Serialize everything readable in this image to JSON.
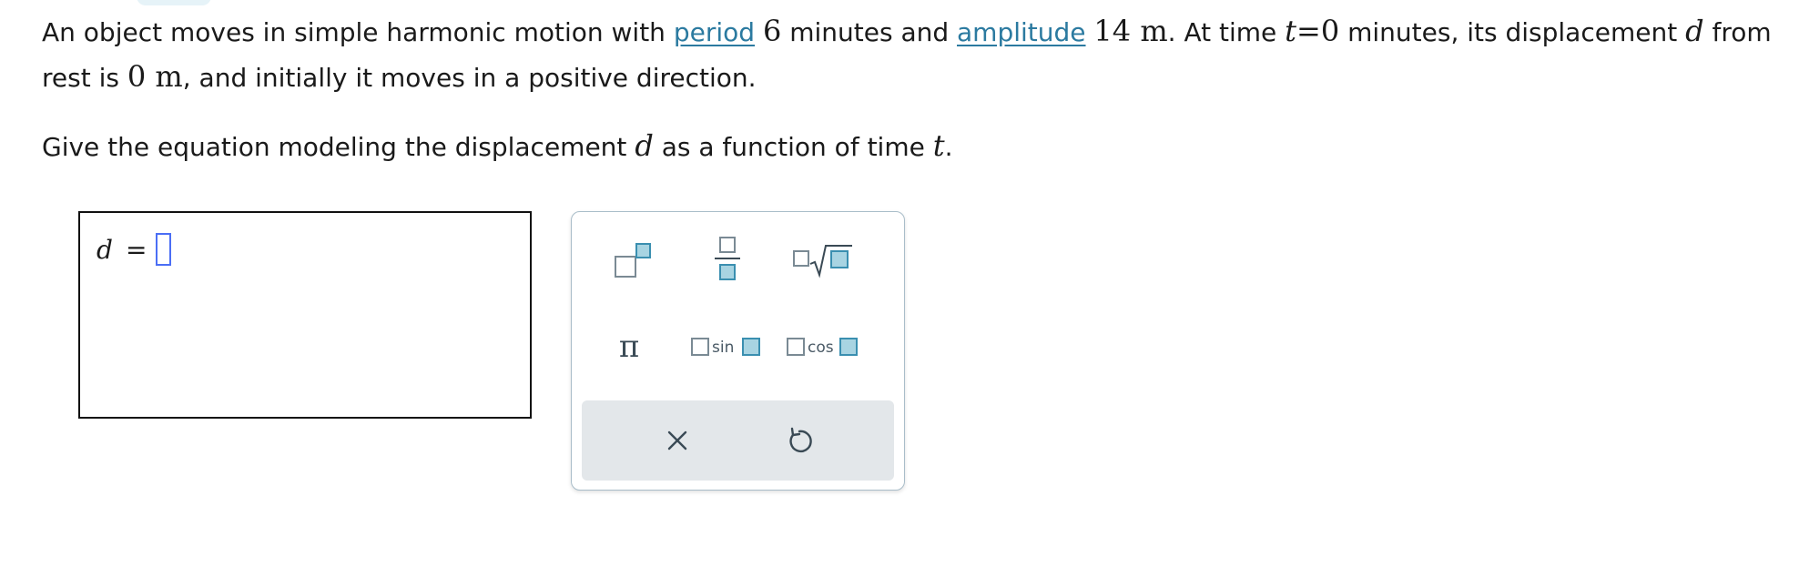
{
  "problem": {
    "s1": "An object moves in simple harmonic motion with ",
    "link_period": "period",
    "s2": " ",
    "period_value": "6",
    "s3": " minutes and ",
    "link_amplitude": "amplitude",
    "s4": " ",
    "amplitude_value": "14 m",
    "s5": ". At time ",
    "t_var": "t",
    "t_eq": "=0",
    "s6": " minutes, its displacement ",
    "d_var": "d",
    "s7": " from rest is ",
    "rest_value": "0 m",
    "s8": ", and initially it moves in a positive direction."
  },
  "question": {
    "s1": "Give the equation modeling the displacement ",
    "d_var": "d",
    "s2": " as a function of time ",
    "t_var": "t",
    "s3": "."
  },
  "answer": {
    "lhs": "d",
    "equals": "=",
    "value": ""
  },
  "keypad": {
    "pi": "π",
    "sin": "sin",
    "cos": "cos"
  },
  "colors": {
    "link": "#2b7aa0",
    "cursor": "#4b6ef5",
    "key_fill": "#a8d4e2"
  },
  "icons": [
    "superscript-template-icon",
    "fraction-template-icon",
    "nth-root-template-icon",
    "pi-icon",
    "sin-template-icon",
    "cos-template-icon",
    "clear-icon",
    "undo-icon"
  ]
}
